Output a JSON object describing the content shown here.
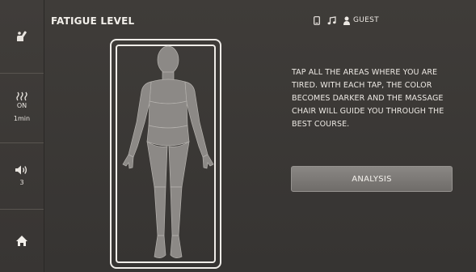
{
  "header": {
    "title": "FATIGUE LEVEL",
    "user_label": "GUEST"
  },
  "sidebar": {
    "heat": {
      "status": "ON",
      "duration": "1min"
    },
    "volume": {
      "level": "3"
    }
  },
  "main": {
    "instructions": "TAP ALL THE AREAS WHERE YOU ARE TIRED. WITH EACH TAP, THE COLOR BECOMES DARKER AND THE MASSAGE CHAIR WILL GUIDE YOU THROUGH THE BEST COURSE.",
    "analysis_button": "ANALYSIS"
  },
  "icons": {
    "sidebar": [
      "massage-chair-icon",
      "heat-icon",
      "speaker-icon",
      "home-icon"
    ],
    "status": [
      "phone-icon",
      "music-note-icon",
      "user-icon"
    ]
  },
  "colors": {
    "background": "#3a3836",
    "body_fill": "#8a8784",
    "frame": "#efece8",
    "button": "#7e7b78",
    "text": "#ece8e3"
  }
}
